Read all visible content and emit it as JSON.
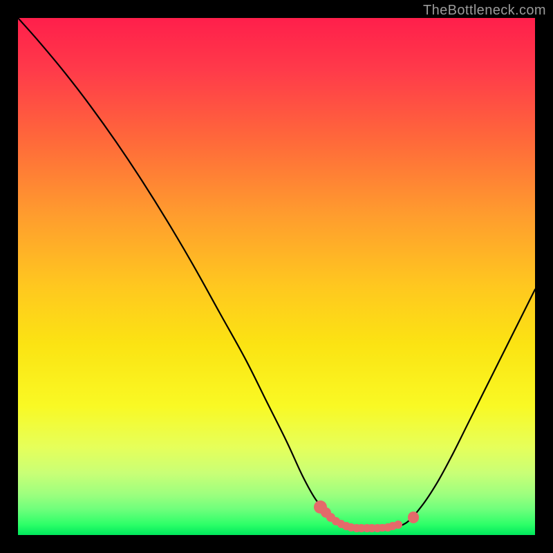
{
  "watermark": "TheBottleneck.com",
  "colors": {
    "frame": "#000000",
    "curve": "#000000",
    "marker": "#e46a6a",
    "watermark": "#9a9a9a",
    "gradient_stops": [
      {
        "pct": 0,
        "hex": "#ff1f4b"
      },
      {
        "pct": 10,
        "hex": "#ff3a4a"
      },
      {
        "pct": 24,
        "hex": "#ff6a3a"
      },
      {
        "pct": 38,
        "hex": "#ff9c2e"
      },
      {
        "pct": 52,
        "hex": "#ffc81f"
      },
      {
        "pct": 63,
        "hex": "#fbe313"
      },
      {
        "pct": 75,
        "hex": "#f9f924"
      },
      {
        "pct": 83,
        "hex": "#e6ff5a"
      },
      {
        "pct": 88,
        "hex": "#c9ff76"
      },
      {
        "pct": 92,
        "hex": "#9fff7e"
      },
      {
        "pct": 95,
        "hex": "#6fff7c"
      },
      {
        "pct": 98,
        "hex": "#2cff68"
      },
      {
        "pct": 100,
        "hex": "#00e85c"
      }
    ]
  },
  "chart_data": {
    "type": "line",
    "title": "",
    "xlabel": "",
    "ylabel": "",
    "xlim": [
      0,
      100
    ],
    "ylim": [
      0,
      100
    ],
    "series": [
      {
        "name": "bottleneck-curve",
        "points": [
          {
            "x": 0.0,
            "y": 100.0
          },
          {
            "x": 4.0,
            "y": 95.5
          },
          {
            "x": 9.0,
            "y": 89.5
          },
          {
            "x": 14.0,
            "y": 83.0
          },
          {
            "x": 19.0,
            "y": 76.0
          },
          {
            "x": 24.0,
            "y": 68.5
          },
          {
            "x": 29.0,
            "y": 60.5
          },
          {
            "x": 34.0,
            "y": 52.0
          },
          {
            "x": 39.0,
            "y": 43.0
          },
          {
            "x": 44.0,
            "y": 34.0
          },
          {
            "x": 48.0,
            "y": 26.0
          },
          {
            "x": 52.0,
            "y": 18.0
          },
          {
            "x": 55.0,
            "y": 11.5
          },
          {
            "x": 57.5,
            "y": 7.0
          },
          {
            "x": 60.0,
            "y": 4.0
          },
          {
            "x": 63.0,
            "y": 2.0
          },
          {
            "x": 66.0,
            "y": 1.3
          },
          {
            "x": 69.0,
            "y": 1.3
          },
          {
            "x": 72.0,
            "y": 1.5
          },
          {
            "x": 75.0,
            "y": 2.3
          },
          {
            "x": 78.0,
            "y": 5.5
          },
          {
            "x": 81.0,
            "y": 10.0
          },
          {
            "x": 84.0,
            "y": 15.5
          },
          {
            "x": 87.0,
            "y": 21.5
          },
          {
            "x": 90.0,
            "y": 27.5
          },
          {
            "x": 93.0,
            "y": 33.5
          },
          {
            "x": 96.0,
            "y": 39.5
          },
          {
            "x": 99.0,
            "y": 45.5
          },
          {
            "x": 100.0,
            "y": 47.5
          }
        ]
      }
    ],
    "markers": [
      {
        "x": 58.5,
        "y": 5.4,
        "r": 1.3
      },
      {
        "x": 59.5,
        "y": 4.3,
        "r": 1.0
      },
      {
        "x": 60.5,
        "y": 3.4,
        "r": 0.9
      },
      {
        "x": 61.5,
        "y": 2.7,
        "r": 0.8
      },
      {
        "x": 62.5,
        "y": 2.2,
        "r": 0.8
      },
      {
        "x": 63.5,
        "y": 1.8,
        "r": 0.8
      },
      {
        "x": 64.5,
        "y": 1.5,
        "r": 0.8
      },
      {
        "x": 65.5,
        "y": 1.35,
        "r": 0.8
      },
      {
        "x": 66.5,
        "y": 1.3,
        "r": 0.8
      },
      {
        "x": 67.5,
        "y": 1.3,
        "r": 0.8
      },
      {
        "x": 68.5,
        "y": 1.3,
        "r": 0.8
      },
      {
        "x": 69.5,
        "y": 1.35,
        "r": 0.8
      },
      {
        "x": 70.5,
        "y": 1.4,
        "r": 0.8
      },
      {
        "x": 71.5,
        "y": 1.5,
        "r": 0.8
      },
      {
        "x": 72.5,
        "y": 1.7,
        "r": 0.8
      },
      {
        "x": 73.5,
        "y": 2.0,
        "r": 0.8
      },
      {
        "x": 76.5,
        "y": 3.4,
        "r": 1.1
      }
    ]
  }
}
